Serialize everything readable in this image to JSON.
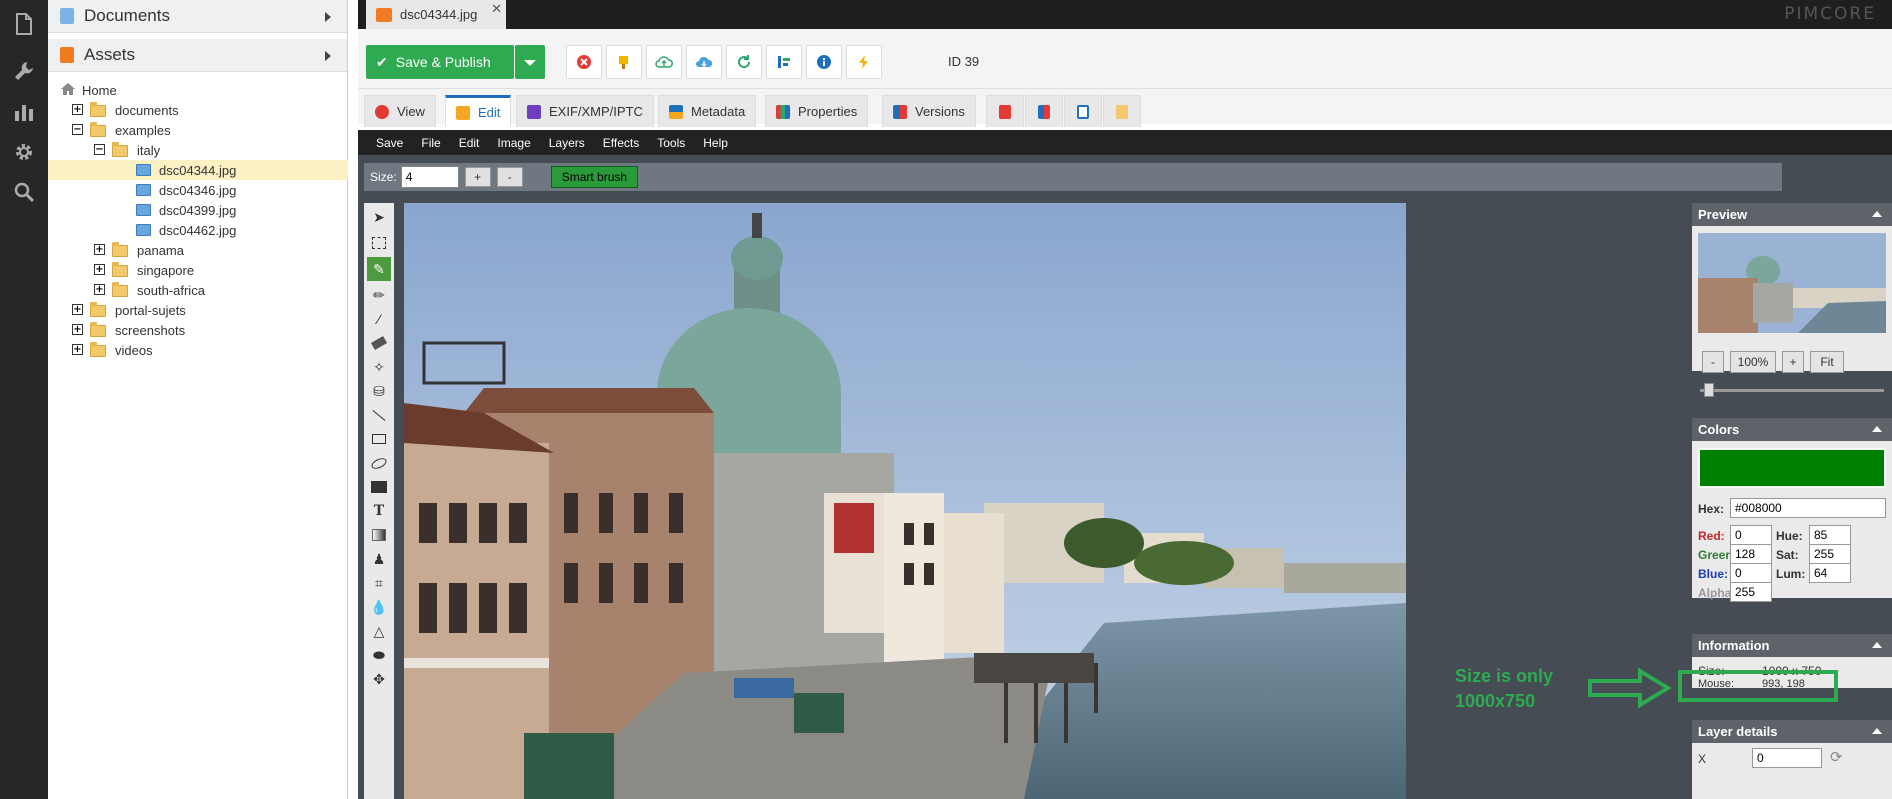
{
  "rail": {
    "icons": [
      "file-icon",
      "wrench-icon",
      "chart-bar-icon",
      "gear-icon",
      "search-icon"
    ]
  },
  "tree_panel": {
    "documents_label": "Documents",
    "assets_label": "Assets",
    "nodes": [
      {
        "label": "Home"
      },
      {
        "label": "documents"
      },
      {
        "label": "examples"
      },
      {
        "label": "italy"
      },
      {
        "label": "dsc04344.jpg"
      },
      {
        "label": "dsc04346.jpg"
      },
      {
        "label": "dsc04399.jpg"
      },
      {
        "label": "dsc04462.jpg"
      },
      {
        "label": "panama"
      },
      {
        "label": "singapore"
      },
      {
        "label": "south-africa"
      },
      {
        "label": "portal-sujets"
      },
      {
        "label": "screenshots"
      },
      {
        "label": "videos"
      }
    ]
  },
  "topbar": {
    "tab_label": "dsc04344.jpg",
    "brand": "PIMCORE"
  },
  "toolbar": {
    "save_label": "Save & Publish",
    "id_label": "ID 39"
  },
  "subtabs": [
    "View",
    "Edit",
    "EXIF/XMP/IPTC",
    "Metadata",
    "Properties",
    "Versions"
  ],
  "editor": {
    "menu": [
      "Save",
      "File",
      "Edit",
      "Image",
      "Layers",
      "Effects",
      "Tools",
      "Help"
    ],
    "size_label": "Size:",
    "size_value": "4",
    "plus": "+",
    "minus": "-",
    "smart_brush": "Smart brush"
  },
  "preview": {
    "title": "Preview",
    "zoom_out": "-",
    "zoom_value": "100%",
    "zoom_in": "+",
    "fit": "Fit"
  },
  "colors": {
    "title": "Colors",
    "swatch": "#008000",
    "hex_label": "Hex:",
    "hex_value": "#008000",
    "red_label": "Red:",
    "red": "0",
    "green_label": "Green:",
    "green": "128",
    "blue_label": "Blue:",
    "blue": "0",
    "alpha_label": "Alpha:",
    "alpha": "255",
    "hue_label": "Hue:",
    "hue": "85",
    "sat_label": "Sat:",
    "sat": "255",
    "lum_label": "Lum:",
    "lum": "64"
  },
  "information": {
    "title": "Information",
    "size_label": "Size:",
    "size_value": "1000 x 750",
    "mouse_label": "Mouse:",
    "mouse_value": "993, 198"
  },
  "layer_details": {
    "title": "Layer details",
    "x_label": "X",
    "x_value": "0"
  },
  "annotation": {
    "line1": "Size is only",
    "line2": "1000x750",
    "color": "#2eaa50"
  }
}
